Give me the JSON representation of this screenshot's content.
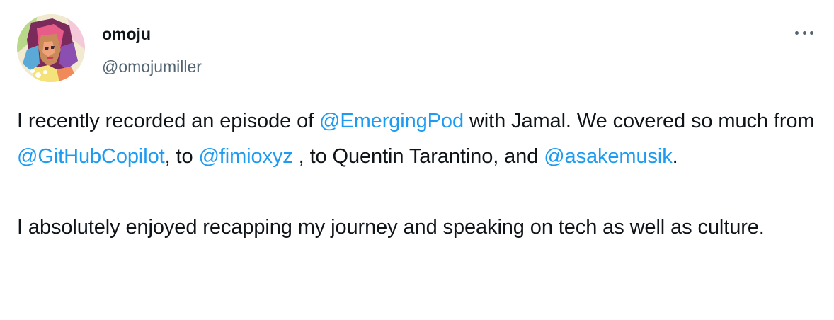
{
  "author": {
    "display_name": "omoju",
    "handle": "@omojumiller",
    "avatar_icon": "pop-art-portrait-avatar"
  },
  "more_icon": "more-horizontal-icon",
  "colors": {
    "text": "#0f1419",
    "secondary": "#536471",
    "link": "#1d9bf0"
  },
  "tweet": {
    "p1": {
      "t1": "I recently recorded an episode of ",
      "m1": "@EmergingPod",
      "t2": " with Jamal. We covered so much from ",
      "m2": "@GitHubCopilot",
      "t3": ", to ",
      "m3": "@fimioxyz",
      "t4": " , to Quentin Tarantino, and ",
      "m4": "@asakemusik",
      "t5": "."
    },
    "p2": "I absolutely enjoyed recapping my journey and speaking on tech as well as culture."
  }
}
